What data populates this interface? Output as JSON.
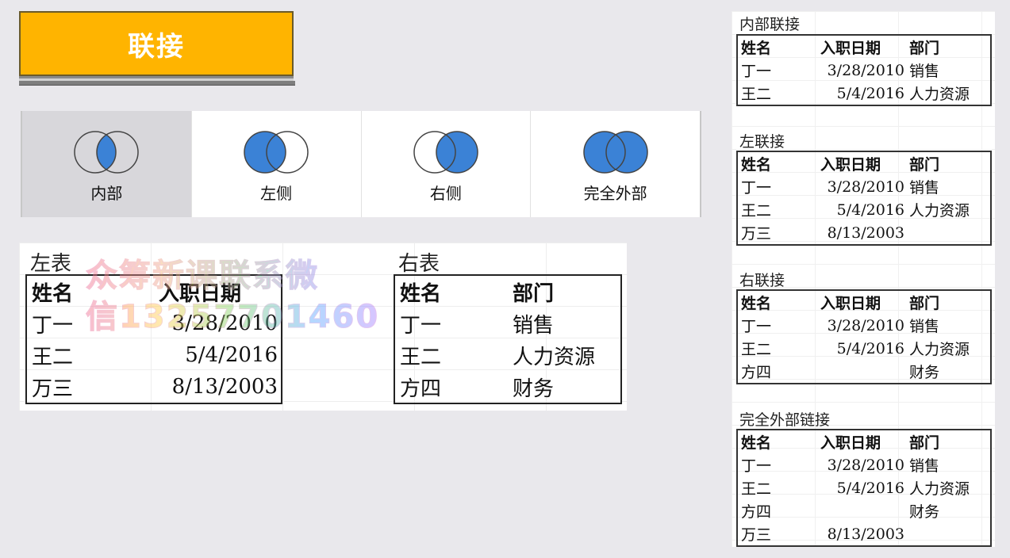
{
  "title_button": "联接",
  "join_kinds": [
    {
      "label": "内部",
      "icon": "inner-join-venn-icon"
    },
    {
      "label": "左侧",
      "icon": "left-join-venn-icon"
    },
    {
      "label": "右侧",
      "icon": "right-join-venn-icon"
    },
    {
      "label": "完全外部",
      "icon": "full-outer-join-venn-icon"
    }
  ],
  "selected_join": "内部",
  "colors": {
    "accent": "#ffb400",
    "venn_fill": "#3b82d6",
    "selected_bg": "#d8d7db"
  },
  "left_table": {
    "caption": "左表",
    "headers": [
      "姓名",
      "入职日期"
    ],
    "rows": [
      [
        "丁一",
        "3/28/2010"
      ],
      [
        "王二",
        "5/4/2016"
      ],
      [
        "万三",
        "8/13/2003"
      ]
    ]
  },
  "right_table": {
    "caption": "右表",
    "headers": [
      "姓名",
      "部门"
    ],
    "rows": [
      [
        "丁一",
        "销售"
      ],
      [
        "王二",
        "人力资源"
      ],
      [
        "方四",
        "财务"
      ]
    ]
  },
  "watermark": {
    "line1": "众筹新课联系微",
    "line2": "信13257701460"
  },
  "results": [
    {
      "caption": "内部联接",
      "headers": [
        "姓名",
        "入职日期",
        "部门"
      ],
      "rows": [
        [
          "丁一",
          "3/28/2010",
          "销售"
        ],
        [
          "王二",
          "5/4/2016",
          "人力资源"
        ]
      ]
    },
    {
      "caption": "左联接",
      "headers": [
        "姓名",
        "入职日期",
        "部门"
      ],
      "rows": [
        [
          "丁一",
          "3/28/2010",
          "销售"
        ],
        [
          "王二",
          "5/4/2016",
          "人力资源"
        ],
        [
          "万三",
          "8/13/2003",
          ""
        ]
      ]
    },
    {
      "caption": "右联接",
      "headers": [
        "姓名",
        "入职日期",
        "部门"
      ],
      "rows": [
        [
          "丁一",
          "3/28/2010",
          "销售"
        ],
        [
          "王二",
          "5/4/2016",
          "人力资源"
        ],
        [
          "方四",
          "",
          "财务"
        ]
      ]
    },
    {
      "caption": "完全外部链接",
      "headers": [
        "姓名",
        "入职日期",
        "部门"
      ],
      "rows": [
        [
          "丁一",
          "3/28/2010",
          "销售"
        ],
        [
          "王二",
          "5/4/2016",
          "人力资源"
        ],
        [
          "方四",
          "",
          "财务"
        ],
        [
          "万三",
          "8/13/2003",
          ""
        ]
      ]
    }
  ]
}
